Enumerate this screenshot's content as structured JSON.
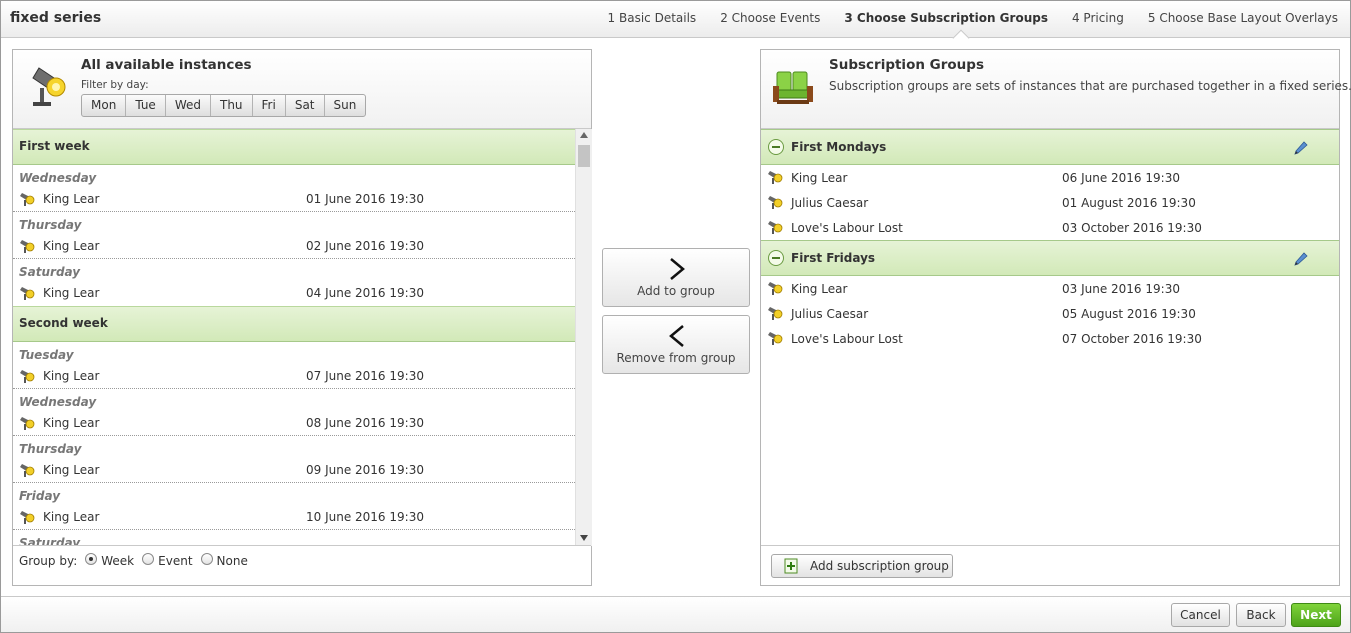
{
  "app": {
    "title": "fixed series"
  },
  "steps": [
    {
      "label": "1 Basic Details",
      "active": false
    },
    {
      "label": "2 Choose Events",
      "active": false
    },
    {
      "label": "3 Choose Subscription Groups",
      "active": true
    },
    {
      "label": "4 Pricing",
      "active": false
    },
    {
      "label": "5 Choose Base Layout Overlays",
      "active": false
    }
  ],
  "left_panel": {
    "title": "All available instances",
    "filter_label": "Filter by day:",
    "days": [
      "Mon",
      "Tue",
      "Wed",
      "Thu",
      "Fri",
      "Sat",
      "Sun"
    ],
    "weeks": [
      {
        "label": "First week",
        "days": [
          {
            "day": "Wednesday",
            "event": "King Lear",
            "date": "01 June 2016 19:30"
          },
          {
            "day": "Thursday",
            "event": "King Lear",
            "date": "02 June 2016 19:30"
          },
          {
            "day": "Saturday",
            "event": "King Lear",
            "date": "04 June 2016 19:30"
          }
        ]
      },
      {
        "label": "Second week",
        "days": [
          {
            "day": "Tuesday",
            "event": "King Lear",
            "date": "07 June 2016 19:30"
          },
          {
            "day": "Wednesday",
            "event": "King Lear",
            "date": "08 June 2016 19:30"
          },
          {
            "day": "Thursday",
            "event": "King Lear",
            "date": "09 June 2016 19:30"
          },
          {
            "day": "Friday",
            "event": "King Lear",
            "date": "10 June 2016 19:30"
          },
          {
            "day": "Saturday",
            "event": "",
            "date": ""
          }
        ]
      }
    ],
    "group_by": {
      "label": "Group by:",
      "options": [
        {
          "label": "Week",
          "checked": true
        },
        {
          "label": "Event",
          "checked": false
        },
        {
          "label": "None",
          "checked": false
        }
      ]
    }
  },
  "middle": {
    "add_label": "Add to group",
    "remove_label": "Remove from group"
  },
  "right_panel": {
    "title": "Subscription Groups",
    "description": "Subscription groups are sets of instances that are purchased together in a fixed series.",
    "groups": [
      {
        "name": "First Mondays",
        "rows": [
          {
            "event": "King Lear",
            "date": "06 June 2016 19:30"
          },
          {
            "event": "Julius Caesar",
            "date": "01 August 2016 19:30"
          },
          {
            "event": "Love's Labour Lost",
            "date": "03 October 2016 19:30"
          }
        ]
      },
      {
        "name": "First Fridays",
        "rows": [
          {
            "event": "King Lear",
            "date": "03 June 2016 19:30"
          },
          {
            "event": "Julius Caesar",
            "date": "05 August 2016 19:30"
          },
          {
            "event": "Love's Labour Lost",
            "date": "07 October 2016 19:30"
          }
        ]
      }
    ],
    "add_group_label": "Add subscription group"
  },
  "footer": {
    "cancel_label": "Cancel",
    "back_label": "Back",
    "next_label": "Next"
  },
  "colors": {
    "group_header": "#d2e9b8",
    "next_button": "#4ea31a"
  }
}
